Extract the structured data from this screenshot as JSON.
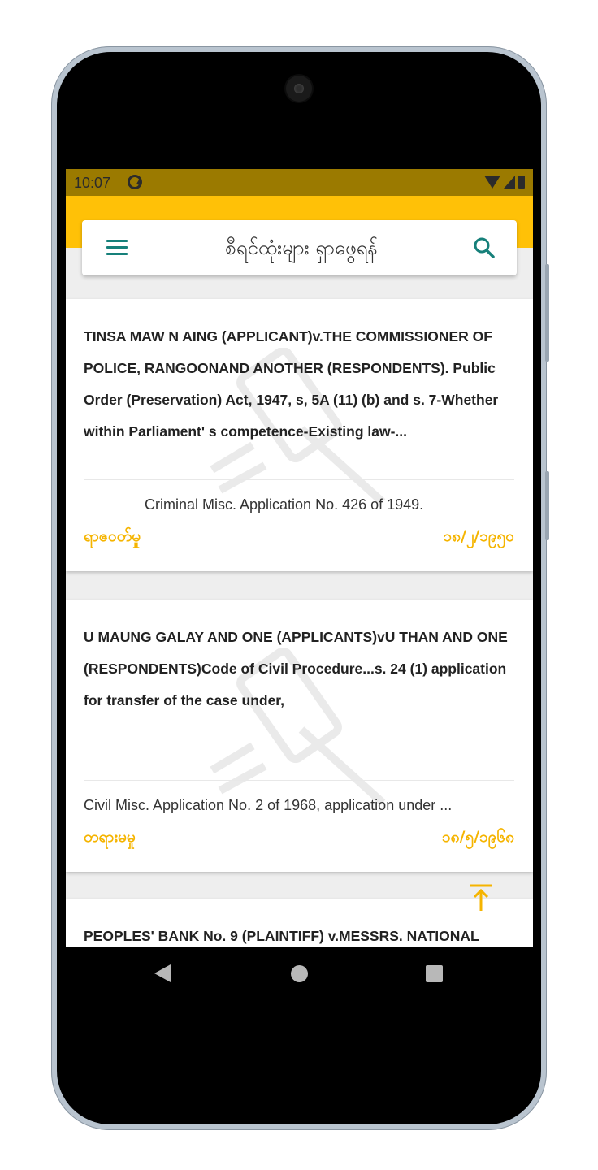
{
  "status_bar": {
    "time": "10:07",
    "app_icon": "at-sign-icon",
    "wifi_icon": "wifi-icon",
    "signal_icon": "signal-icon",
    "battery_icon": "battery-icon"
  },
  "header": {
    "title": "စီရင်ထုံးများ ရှာဖွေရန်",
    "menu_icon": "hamburger-menu-icon",
    "search_icon": "search-icon",
    "accent_color": "#ffc107",
    "icon_color": "#16807a"
  },
  "cases": [
    {
      "title": "TINSA MAW N AING (APPLICANT)v.THE COMMISSIONER OF POLICE, RANGOONAND ANOTHER (RESPONDENTS). Public Order (Preservation) Act, 1947, s, 5A (11) (b) and s. 7-Whether within Parliament' s competence-Existing law-...",
      "reference": "Criminal Misc. Application No. 426 of 1949.",
      "case_type": "ရာဇဝတ်မှု",
      "date": "၁၈/၂/၁၉၅၀"
    },
    {
      "title": "U MAUNG GALAY AND ONE (APPLICANTS)vU THAN AND ONE (RESPONDENTS)Code of Civil Procedure...s. 24 (1) application for transfer of the case under,",
      "reference": "Civil Misc. Application No. 2 of 1968, application under ...",
      "case_type": "တရားမမှု",
      "date": "၁၈/၅/၁၉၆၈"
    },
    {
      "title": "PEOPLES' BANK No. 9 (PLAINTIFF) v.MESSRS. NATIONAL"
    }
  ],
  "scroll_top_icon": "arrow-up-to-top-icon",
  "nav": {
    "back_icon": "back-triangle-icon",
    "home_icon": "home-circle-icon",
    "recent_icon": "recent-apps-square-icon"
  },
  "colors": {
    "status_bar": "#9b7a00",
    "highlight": "#f5b400"
  }
}
